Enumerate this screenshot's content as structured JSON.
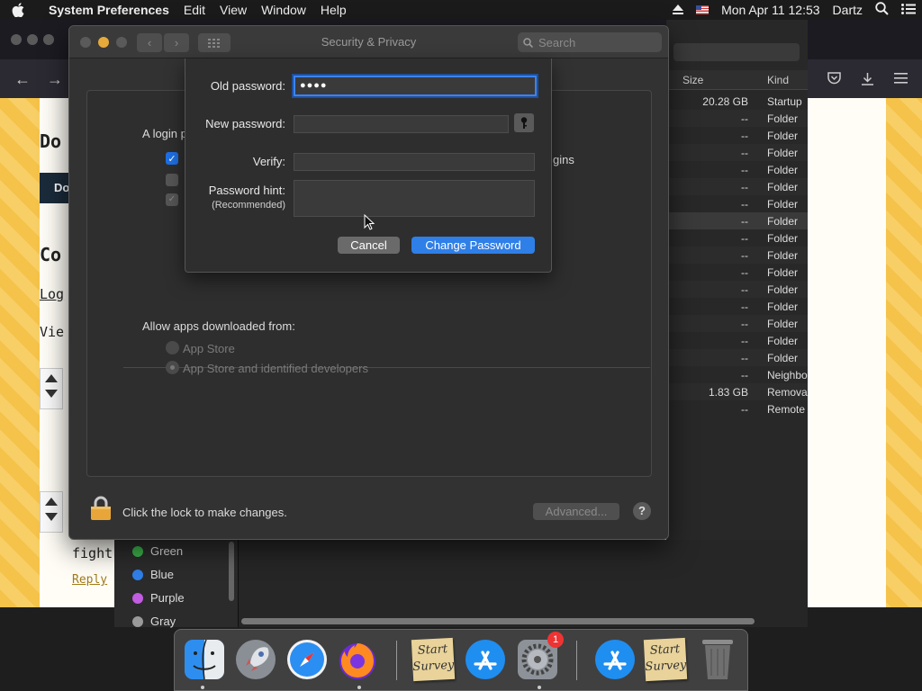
{
  "menubar": {
    "app_name": "System Preferences",
    "menus": [
      "Edit",
      "View",
      "Window",
      "Help"
    ],
    "datetime": "Mon Apr 11  12:53",
    "user": "Dartz"
  },
  "browser": {
    "page_snippets": {
      "heading1": "Do",
      "button": "Do",
      "heading2": "Co",
      "link": "Log",
      "text1": "Vie",
      "text2": "fight",
      "reply": "Reply"
    }
  },
  "finder": {
    "col_size": "Size",
    "col_kind": "Kind",
    "rows": [
      {
        "size": "20.28 GB",
        "kind": "Startup"
      },
      {
        "size": "--",
        "kind": "Folder"
      },
      {
        "size": "--",
        "kind": "Folder"
      },
      {
        "size": "--",
        "kind": "Folder"
      },
      {
        "size": "--",
        "kind": "Folder"
      },
      {
        "size": "--",
        "kind": "Folder"
      },
      {
        "size": "--",
        "kind": "Folder"
      },
      {
        "size": "--",
        "kind": "Folder"
      },
      {
        "size": "--",
        "kind": "Folder"
      },
      {
        "size": "--",
        "kind": "Folder"
      },
      {
        "size": "--",
        "kind": "Folder"
      },
      {
        "size": "--",
        "kind": "Folder"
      },
      {
        "size": "--",
        "kind": "Folder"
      },
      {
        "size": "--",
        "kind": "Folder"
      },
      {
        "size": "--",
        "kind": "Folder"
      },
      {
        "size": "--",
        "kind": "Folder"
      },
      {
        "size": "--",
        "kind": "Neighbo"
      },
      {
        "size": "1.83 GB",
        "kind": "Remova"
      },
      {
        "size": "--",
        "kind": "Remote"
      }
    ],
    "tags": [
      {
        "name": "Green",
        "color": "#3bb54a"
      },
      {
        "name": "Blue",
        "color": "#2f7fe8"
      },
      {
        "name": "Purple",
        "color": "#c25ce0"
      },
      {
        "name": "Gray",
        "color": "#9a9a9a"
      }
    ]
  },
  "security_window": {
    "title": "Security & Privacy",
    "search_placeholder": "Search",
    "login_label": "A login p",
    "login_right_text": "gins",
    "allow_apps_label": "Allow apps downloaded from:",
    "radio_app_store": "App Store",
    "radio_identified": "App Store and identified developers",
    "lock_text": "Click the lock to make changes.",
    "advanced_button": "Advanced...",
    "help_button": "?"
  },
  "change_password_sheet": {
    "old_password_label": "Old password:",
    "old_password_value": "●●●●",
    "new_password_label": "New password:",
    "verify_label": "Verify:",
    "hint_label": "Password hint:",
    "hint_sub": "(Recommended)",
    "cancel_button": "Cancel",
    "change_button": "Change Password"
  },
  "dock": {
    "sticky_text": "Start Survey",
    "appstore_badge": "1"
  }
}
